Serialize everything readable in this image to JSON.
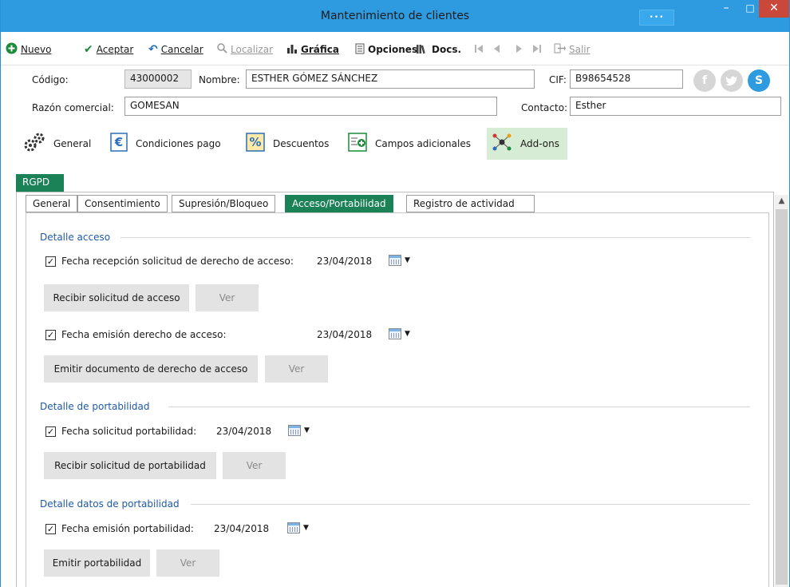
{
  "window": {
    "title": "Mantenimiento de clientes",
    "dots_button": "•••",
    "minimize": "–",
    "maximize": "□",
    "close": "✕"
  },
  "toolbar": {
    "nuevo": "Nuevo",
    "aceptar": "Aceptar",
    "cancelar": "Cancelar",
    "localizar": "Localizar",
    "grafica": "Gráfica",
    "opciones": "Opciones",
    "docs": "Docs.",
    "salir": "Salir"
  },
  "header": {
    "codigo_label": "Código:",
    "codigo_value": "43000002",
    "nombre_label": "Nombre:",
    "nombre_value": "ESTHER GÓMEZ SÁNCHEZ",
    "cif_label": "CIF:",
    "cif_value": "B98654528",
    "razon_label": "Razón comercial:",
    "razon_value": "GOMESAN",
    "contacto_label": "Contacto:",
    "contacto_value": "Esther"
  },
  "section_tabs": [
    {
      "label": "General",
      "icon": "gears-icon"
    },
    {
      "label": "Condiciones pago",
      "icon": "euro-document-icon"
    },
    {
      "label": "Descuentos",
      "icon": "percent-icon"
    },
    {
      "label": "Campos adicionales",
      "icon": "add-field-icon"
    },
    {
      "label": "Add-ons",
      "icon": "network-icon"
    }
  ],
  "rgpd": {
    "badge": "RGPD",
    "tabs": [
      "General",
      "Consentimiento",
      "Supresión/Bloqueo",
      "Acceso/Portabilidad",
      "Registro de actividad"
    ],
    "active_tab": "Acceso/Portabilidad"
  },
  "acceso": {
    "title": "Detalle acceso",
    "recepcion_label": "Fecha recepción solicitud de derecho de acceso:",
    "recepcion_date": "23/04/2018",
    "recibir_button": "Recibir solicitud de acceso",
    "ver1_button": "Ver",
    "emision_label": "Fecha emisión derecho de acceso:",
    "emision_date": "23/04/2018",
    "emitir_button": "Emitir documento de derecho de acceso",
    "ver2_button": "Ver"
  },
  "portabilidad": {
    "title": "Detalle de portabilidad",
    "solicitud_label": "Fecha solicitud portabilidad:",
    "solicitud_date": "23/04/2018",
    "recibir_button": "Recibir solicitud de portabilidad",
    "ver_button": "Ver"
  },
  "datos_portabilidad": {
    "title": "Detalle datos de portabilidad",
    "emision_label": "Fecha emisión portabilidad:",
    "emision_date": "23/04/2018",
    "emitir_button": "Emitir portabilidad",
    "ver_button": "Ver"
  },
  "checkbox_mark": "✓",
  "colors": {
    "titlebar": "#2e9be0",
    "accent_green": "#1b8157",
    "group_title": "#1f5aa6"
  }
}
